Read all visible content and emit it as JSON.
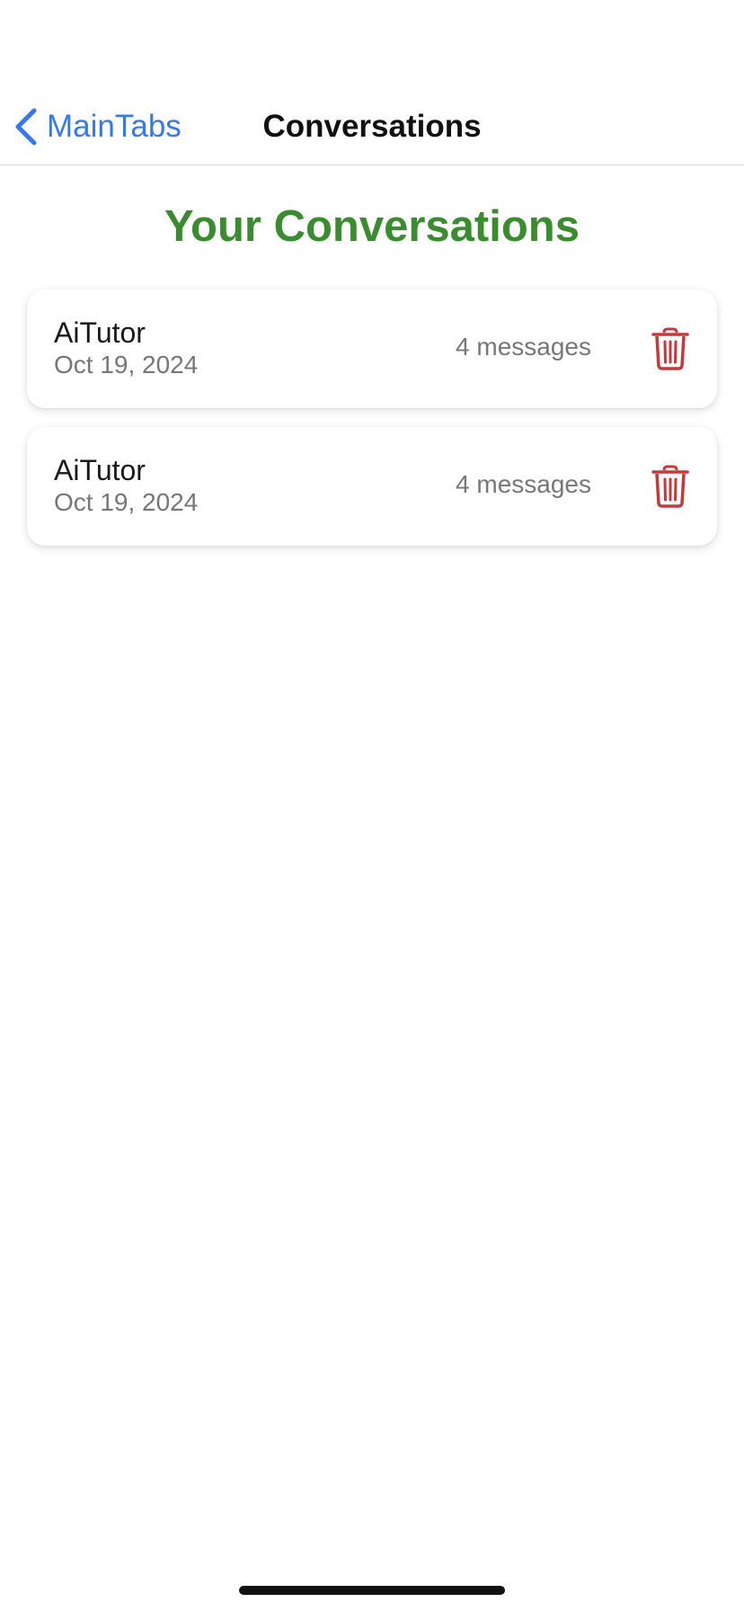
{
  "navbar": {
    "back_label": "MainTabs",
    "title": "Conversations"
  },
  "page": {
    "heading": "Your Conversations"
  },
  "conversations": [
    {
      "name": "AiTutor",
      "date": "Oct 19, 2024",
      "message_count": "4 messages"
    },
    {
      "name": "AiTutor",
      "date": "Oct 19, 2024",
      "message_count": "4 messages"
    }
  ],
  "colors": {
    "accent_blue": "#3478f6",
    "heading_green": "#3a8d2e",
    "delete_red": "#c8383a"
  },
  "icons": {
    "back": "chevron-left-icon",
    "delete": "trash-icon"
  }
}
